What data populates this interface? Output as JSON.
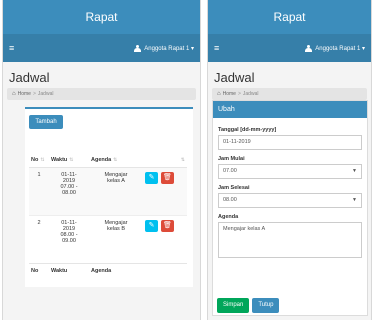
{
  "left": {
    "title": "Rapat",
    "nav": {
      "user_label": "Anggota Rapat 1 ▾"
    },
    "page_title": "Jadwal",
    "breadcrumb": {
      "home": "Home",
      "sep": ">",
      "current": "Jadwal"
    },
    "add_button": "Tambah",
    "table": {
      "headers": {
        "no": "No",
        "waktu": "Waktu",
        "agenda": "Agenda"
      },
      "sort_icons": {
        "no": "⇅",
        "waktu": "⇅",
        "agenda": "⇅",
        "actions": "⇅"
      },
      "rows": [
        {
          "no": "1",
          "date": "01-11-",
          "year": "2019",
          "time1": "07.00 -",
          "time2": "08.00",
          "agenda1": "Mengajar",
          "agenda2": "kelas A"
        },
        {
          "no": "2",
          "date": "01-11-",
          "year": "2019",
          "time1": "08.00 -",
          "time2": "09.00",
          "agenda1": "Mengajar",
          "agenda2": "kelas B"
        }
      ],
      "footer": {
        "no": "No",
        "waktu": "Waktu",
        "agenda": "Agenda"
      }
    }
  },
  "right": {
    "title": "Rapat",
    "nav": {
      "user_label": "Anggota Rapat 1 ▾"
    },
    "page_title": "Jadwal",
    "breadcrumb": {
      "home": "Home",
      "sep": ">",
      "current": "Jadwal"
    },
    "form": {
      "header": "Ubah",
      "tanggal_label": "Tanggal [dd-mm-yyyy]",
      "tanggal_value": "01-11-2019",
      "mulai_label": "Jam Mulai",
      "mulai_value": "07.00",
      "selesai_label": "Jam Selesai",
      "selesai_value": "08.00",
      "agenda_label": "Agenda",
      "agenda_value": "Mengajar kelas A",
      "save_button": "Simpan",
      "close_button": "Tutup"
    }
  },
  "colors": {
    "primary": "#3c8dbc",
    "success": "#00a65a",
    "info": "#00c0ef",
    "danger": "#dd4b39"
  }
}
